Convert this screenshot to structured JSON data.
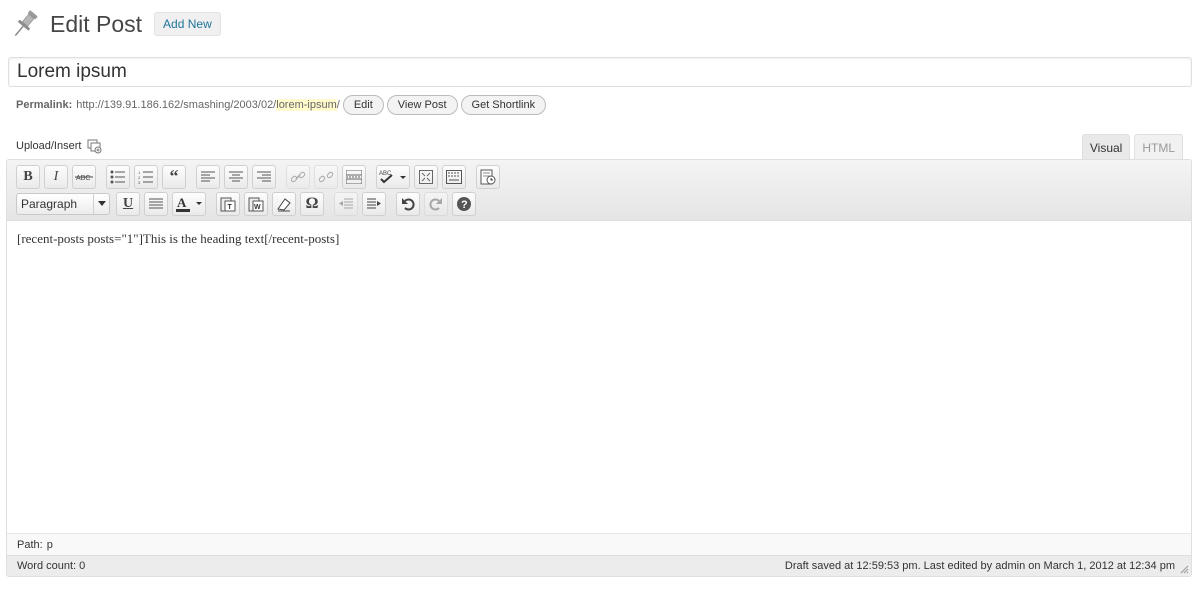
{
  "header": {
    "title": "Edit Post",
    "add_new_label": "Add New"
  },
  "post": {
    "title": "Lorem ipsum"
  },
  "permalink": {
    "label": "Permalink:",
    "base_url": "http://139.91.186.162/smashing/2003/02/",
    "slug": "lorem-ipsum",
    "trailing": "/",
    "edit_label": "Edit",
    "view_label": "View Post",
    "shortlink_label": "Get Shortlink"
  },
  "media": {
    "upload_insert_label": "Upload/Insert"
  },
  "editor_tabs": [
    {
      "label": "Visual",
      "active": true
    },
    {
      "label": "HTML",
      "active": false
    }
  ],
  "toolbar": {
    "row1": [
      "bold-icon",
      "italic-icon",
      "strikethrough-icon",
      "bullet-list-icon",
      "numbered-list-icon",
      "blockquote-icon",
      "align-left-icon",
      "align-center-icon",
      "align-right-icon",
      "link-icon",
      "unlink-icon",
      "more-tag-icon",
      "spellcheck-icon",
      "fullscreen-icon",
      "kitchen-sink-icon",
      "preview-icon"
    ],
    "format_value": "Paragraph",
    "row2": [
      "underline-icon",
      "justify-icon",
      "text-color-icon",
      "paste-text-icon",
      "paste-word-icon",
      "clear-formatting-icon",
      "special-char-icon",
      "outdent-icon",
      "indent-icon",
      "undo-icon",
      "redo-icon",
      "help-icon"
    ]
  },
  "content": {
    "text": "[recent-posts posts=\"1\"]This is the heading text[/recent-posts]"
  },
  "path": {
    "label": "Path:",
    "value": "p"
  },
  "status": {
    "word_count": "Word count: 0",
    "draft_info": "Draft saved at 12:59:53 pm. Last edited by admin on March 1, 2012 at 12:34 pm"
  },
  "colors": {
    "link": "#21759b",
    "slug_highlight": "#fffbcc",
    "toolbar_bg": "#e9e9e9"
  }
}
